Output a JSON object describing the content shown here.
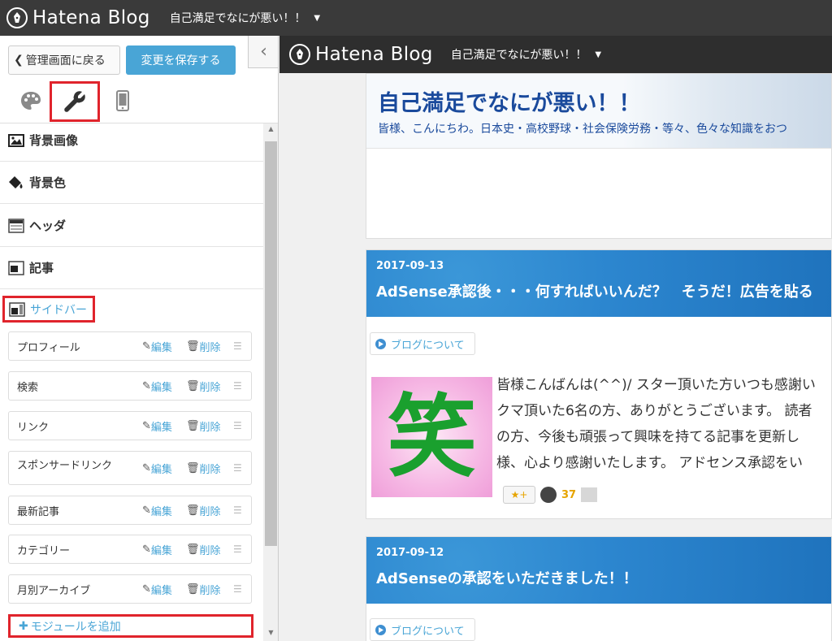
{
  "topbar": {
    "logo_text": "Hatena Blog",
    "blog_name": "自己満足でなにが悪い！！"
  },
  "panel": {
    "back_label": "管理画面に戻る",
    "save_label": "変更を保存する",
    "sections": [
      {
        "label": "背景画像",
        "icon": "image-icon"
      },
      {
        "label": "背景色",
        "icon": "paint-bucket-icon"
      },
      {
        "label": "ヘッダ",
        "icon": "header-layout-icon"
      },
      {
        "label": "記事",
        "icon": "article-layout-icon"
      }
    ],
    "active_section": "サイドバー",
    "modules": [
      {
        "name": "プロフィール"
      },
      {
        "name": "検索"
      },
      {
        "name": "リンク"
      },
      {
        "name": "スポンサードリンク"
      },
      {
        "name": "最新記事"
      },
      {
        "name": "カテゴリー"
      },
      {
        "name": "月別アーカイブ"
      }
    ],
    "edit_label": "編集",
    "delete_label": "削除",
    "add_module_label": "モジュールを追加"
  },
  "preview": {
    "logo_text": "Hatena Blog",
    "blog_name": "自己満足でなにが悪い！！",
    "blog_title": "自己満足でなにが悪い！！",
    "blog_desc": "皆様、こんにちわ。日本史・高校野球・社会保険労務・等々、色々な知識をおつ",
    "articles": [
      {
        "date": "2017-09-13",
        "title": "AdSense承認後・・・何すればいいんだ？　そうだ！広告を貼る",
        "category": "ブログについて",
        "thumb_char": "笑",
        "text_lines": [
          "皆様こんばんは(^^)/ スター頂いた方いつも感謝い",
          "クマ頂いた6名の方、ありがとうございます。 読者",
          "の方、今後も頑張って興味を持てる記事を更新し",
          "様、心より感謝いたします。 アドセンス承認をい"
        ],
        "star_count": "37"
      },
      {
        "date": "2017-09-12",
        "title": "AdSenseの承認をいただきました！！",
        "category": "ブログについて"
      }
    ]
  },
  "colors": {
    "accent": "#49a5d6",
    "highlight": "#e0242c",
    "topbar": "#3a3a3a"
  }
}
